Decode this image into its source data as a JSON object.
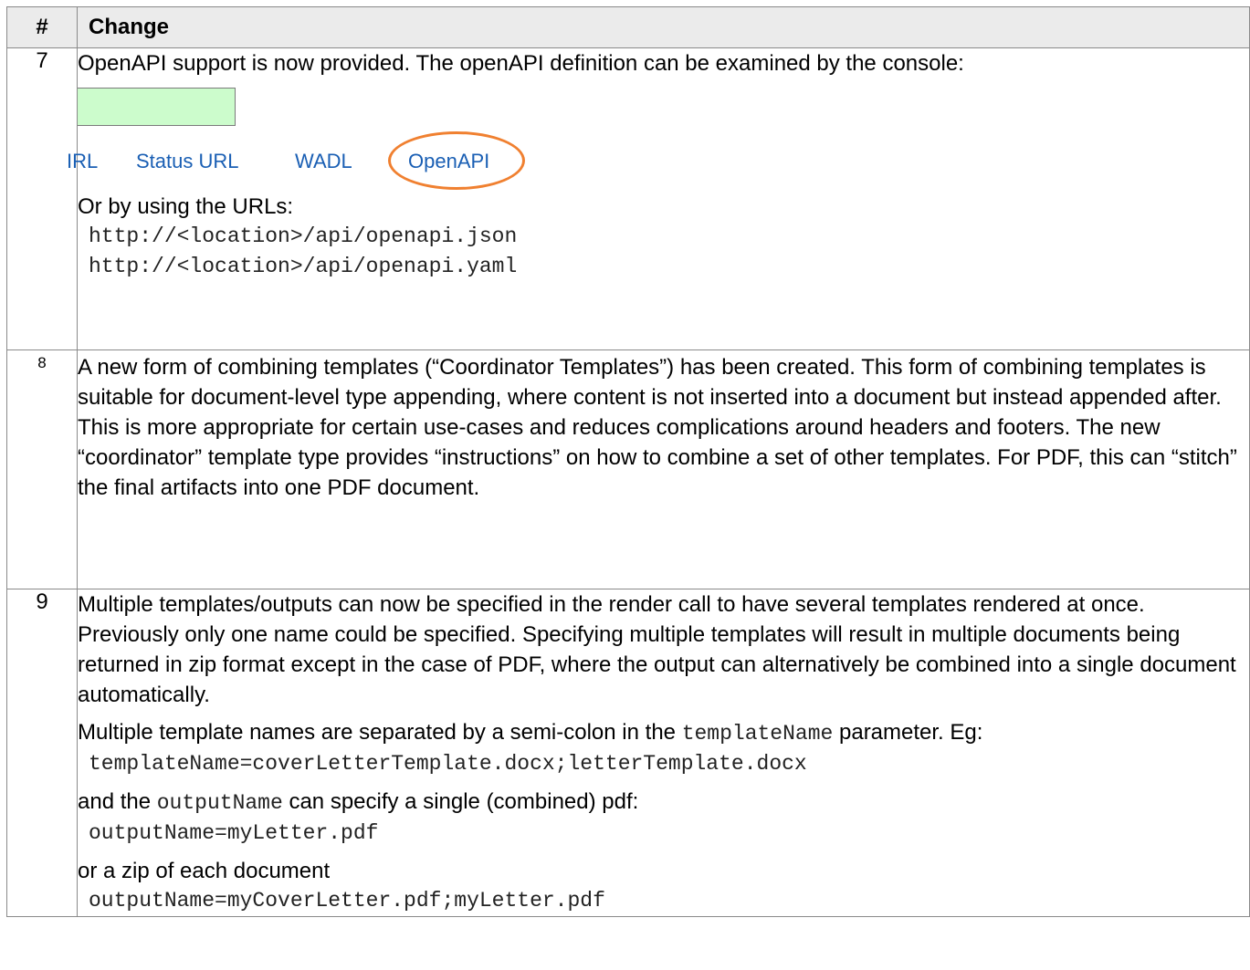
{
  "table": {
    "header": {
      "num": "#",
      "change": "Change"
    },
    "row7": {
      "num": "7",
      "intro": "OpenAPI support is now provided.  The openAPI definition can be examined by the console:",
      "screenshot": {
        "links": [
          "IRL",
          "Status URL",
          "WADL",
          "OpenAPI"
        ],
        "highlight_color": "#f08030",
        "link_color": "#1a5fb4",
        "box_color": "#ccfccc"
      },
      "urls_intro": "Or by using the URLs:",
      "urls": [
        "http://<location>/api/openapi.json",
        "http://<location>/api/openapi.yaml"
      ]
    },
    "row8": {
      "num": "8",
      "text": " A new form of combining templates (“Coordinator Templates”) has been created.  This form of combining templates is suitable for document-level type appending, where content is not inserted into a document but instead appended after.  This is more appropriate for certain use-cases and reduces complications around headers and footers.  The new “coordinator” template type provides “instructions” on how to combine a set of other templates.  For PDF, this can “stitch” the final artifacts into one PDF document."
    },
    "row9": {
      "num": "9",
      "para1": "Multiple templates/outputs can now be specified in the render call to have several templates rendered at once.  Previously only one name could be specified.  Specifying multiple templates will result in multiple documents being returned in zip format except in the case of PDF, where the output can alternatively be combined into a single document automatically.",
      "para2_before": "Multiple template names are separated by a semi-colon in the ",
      "para2_code": "templateName",
      "para2_after": " parameter.  Eg:",
      "code1": "templateName=coverLetterTemplate.docx;letterTemplate.docx",
      "para3_before": "and the ",
      "para3_code": "outputName",
      "para3_after": " can specify a single (combined) pdf:",
      "code2": "outputName=myLetter.pdf",
      "para4": "or a zip of each document",
      "code3": "outputName=myCoverLetter.pdf;myLetter.pdf"
    }
  }
}
